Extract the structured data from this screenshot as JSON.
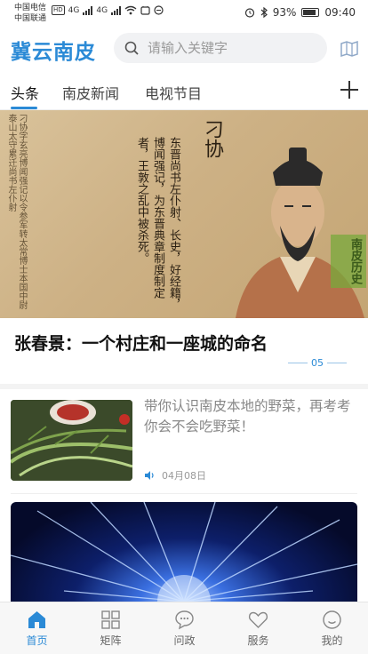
{
  "status": {
    "carrier1": "中国电信",
    "carrier2": "中国联通",
    "hd": "HD",
    "net1": "4G",
    "net2": "4G",
    "battery": "93%",
    "time": "09:40"
  },
  "header": {
    "brand": "冀云南皮",
    "search_placeholder": "请输入关键字",
    "map_icon": "map-icon"
  },
  "tabs": [
    {
      "label": "头条"
    },
    {
      "label": "南皮新闻"
    },
    {
      "label": "电视节目"
    }
  ],
  "banner": {
    "title": "刁协",
    "right_text": "东晋尚书左仆射、长史，好经籍，博闻强记，为东晋典章制度制定者，王敦之乱中被杀死。",
    "left_text": "刁协字玄亮博闻强记以令参军转太常博士本国中尉泰山太守累迁尚书左仆射",
    "seal_text": "南皮历史"
  },
  "headline": {
    "title": "张春景：一个村庄和一座城的命名",
    "page": "05"
  },
  "news": [
    {
      "title": "带你认识南皮本地的野菜，再考考你会不会吃野菜！",
      "date": "04月08日"
    }
  ],
  "bottom_nav": [
    {
      "label": "首页",
      "icon": "home-icon"
    },
    {
      "label": "矩阵",
      "icon": "grid-icon"
    },
    {
      "label": "问政",
      "icon": "chat-icon"
    },
    {
      "label": "服务",
      "icon": "heart-icon"
    },
    {
      "label": "我的",
      "icon": "user-icon"
    }
  ],
  "colors": {
    "accent": "#2b8ad6",
    "text": "#222222",
    "muted": "#999999"
  }
}
